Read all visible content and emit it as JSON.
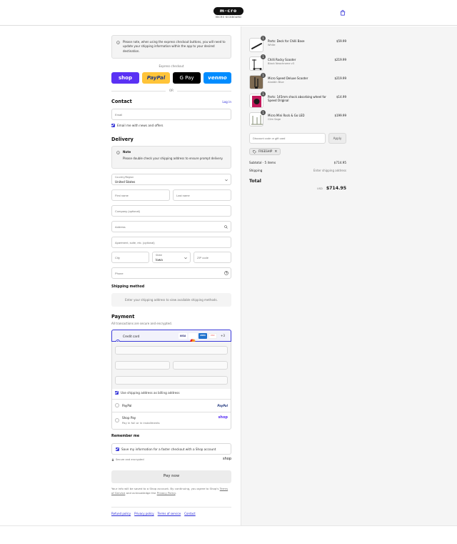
{
  "header": {
    "logo_text": "m-cro",
    "logo_sub": "MICRO KICKBOARD",
    "cart_icon": "shopping-bag-icon"
  },
  "notice": {
    "text": "Please note, when using the express checkout buttons, you will need to update your shipping information within the app to your desired destination."
  },
  "express": {
    "title": "Express checkout",
    "buttons": [
      {
        "label": "shop",
        "color": "#5a31f4"
      },
      {
        "label": "PayPal",
        "color": "#ffc439"
      },
      {
        "label": "G Pay",
        "color": "#000000"
      },
      {
        "label": "venmo",
        "color": "#008cff"
      }
    ],
    "or": "OR"
  },
  "contact": {
    "heading": "Contact",
    "login": "Log in",
    "email_placeholder": "Email",
    "news_label": "Email me with news and offers"
  },
  "delivery": {
    "heading": "Delivery",
    "note_title": "Note",
    "note_text": "Please double check your shipping address to ensure prompt delivery.",
    "country_label": "Country/Region",
    "country_value": "United States",
    "first_name": "First name",
    "last_name": "Last name",
    "company": "Company (optional)",
    "address": "Address",
    "apartment": "Apartment, suite, etc. (optional)",
    "city": "City",
    "state_label": "State",
    "state_value": "Iowa",
    "zip": "ZIP code",
    "phone": "Phone"
  },
  "shipping_method": {
    "heading": "Shipping method",
    "text": "Enter your shipping address to view available shipping methods."
  },
  "payment": {
    "heading": "Payment",
    "subtitle": "All transactions are secure and encrypted.",
    "credit_card": "Credit card",
    "cards": [
      "VISA",
      "MC",
      "AMEX",
      "DISC"
    ],
    "more_cards": "+3",
    "billing_label": "Use shipping address as billing address",
    "paypal": "PayPal",
    "paypal_logo": "PayPal",
    "shop_pay": "Shop Pay",
    "shop_pay_sub": "Pay in full or in installments",
    "shop_pay_logo": "shop"
  },
  "remember": {
    "heading": "Remember me",
    "label": "Save my information for a faster checkout with a Shop account",
    "secure": "Secure and encrypted",
    "shop_logo": "shop"
  },
  "pay_now": "Pay now",
  "legal": {
    "text1": "Your info will be saved to a Shop account. By continuing, you agree to Shop's ",
    "terms": "Terms of Service",
    "text2": " and acknowledge the ",
    "privacy": "Privacy Policy",
    "text3": "."
  },
  "footer_links": [
    "Refund policy",
    "Privacy policy",
    "Terms of service",
    "Contact"
  ],
  "cart": {
    "items": [
      {
        "name": "Parts: Deck for Chilli Base",
        "variant": "White",
        "price": "$59.99",
        "qty": "1"
      },
      {
        "name": "Chilli Rocky Scooter",
        "variant": "Black Neochrome v3",
        "price": "$219.99",
        "qty": "1"
      },
      {
        "name": "Micro Speed Deluxe Scooter",
        "variant": "Aladdin Blue",
        "price": "$219.99",
        "qty": "1"
      },
      {
        "name": "Parts: 145mm shock absorbing wheel for Speed Original",
        "variant": "",
        "price": "$14.99",
        "qty": "1"
      },
      {
        "name": "Micro Mini Rock & Go LED",
        "variant": "Clim Sage",
        "price": "$199.99",
        "qty": "1"
      }
    ],
    "discount_placeholder": "Discount code or gift card",
    "apply": "Apply",
    "tag": "FREESHIP",
    "subtotal_label": "Subtotal · 5 items",
    "subtotal_value": "$714.95",
    "shipping_label": "Shipping",
    "shipping_value": "Enter shipping address",
    "total_label": "Total",
    "currency": "USD",
    "total_value": "$714.95"
  }
}
